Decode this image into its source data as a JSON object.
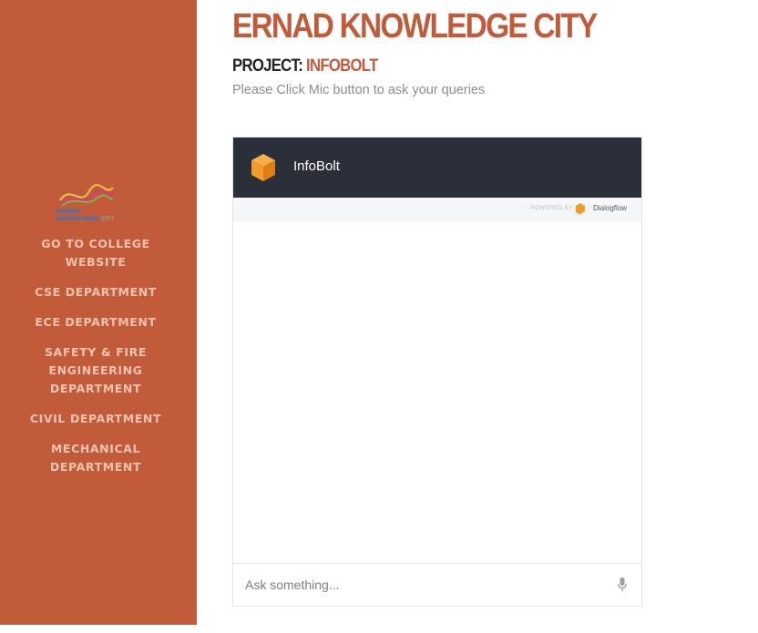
{
  "sidebar": {
    "logo": {
      "line1": "ERNAD",
      "line2_a": "KNOWLEDGE",
      "line2_b": "CITY"
    },
    "items": [
      {
        "label": "GO TO COLLEGE WEBSITE"
      },
      {
        "label": "CSE DEPARTMENT"
      },
      {
        "label": "ECE DEPARTMENT"
      },
      {
        "label": "SAFETY & FIRE ENGINEERING DEPARTMENT"
      },
      {
        "label": "CIVIL DEPARTMENT"
      },
      {
        "label": "MECHANICAL DEPARTMENT"
      }
    ]
  },
  "header": {
    "title": "ERNAD KNOWLEDGE CITY",
    "project_label": "PROJECT:",
    "project_name": "INFOBOLT",
    "subtitle": "Please Click Mic button to ask your queries"
  },
  "chat": {
    "bot_name": "InfoBolt",
    "powered_by": "POWERED BY",
    "provider": "Dialogflow",
    "input_placeholder": "Ask something...",
    "input_value": ""
  },
  "colors": {
    "brand": "#c15b3a",
    "sidebar_text": "#f4c3b0",
    "chat_header": "#2b2f3a",
    "bot_icon": "#f39b2b"
  },
  "icons": {
    "bot": "cube-icon",
    "provider": "dialogflow-icon",
    "mic": "microphone-icon"
  }
}
